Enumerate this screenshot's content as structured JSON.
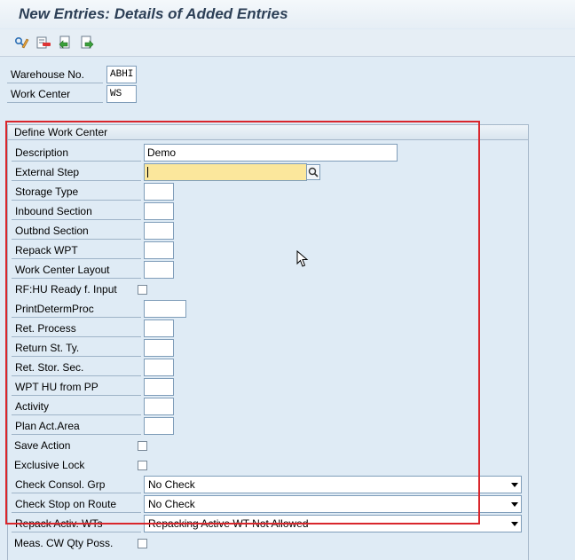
{
  "title": "New Entries: Details of Added Entries",
  "toolbar": [
    {
      "name": "display-change-icon"
    },
    {
      "name": "delete-icon"
    },
    {
      "name": "undo-icon"
    },
    {
      "name": "next-entry-icon"
    }
  ],
  "header": {
    "warehouse_label": "Warehouse No.",
    "warehouse_value": "ABHI",
    "workcenter_label": "Work Center",
    "workcenter_value": "WS"
  },
  "group": {
    "title": "Define Work Center",
    "description_label": "Description",
    "description_value": "Demo",
    "external_step_label": "External Step",
    "external_step_value": "",
    "storage_type_label": "Storage Type",
    "inbound_label": "Inbound Section",
    "outbound_label": "Outbnd Section",
    "repack_wpt_label": "Repack WPT",
    "wc_layout_label": "Work Center Layout",
    "rf_hu_label": "RF:HU Ready f. Input",
    "rf_hu_checked": false,
    "print_label": "PrintDetermProc",
    "ret_process_label": "Ret. Process",
    "return_st_label": "Return St. Ty.",
    "ret_stor_label": "Ret. Stor. Sec.",
    "wpt_hu_label": "WPT HU from PP",
    "activity_label": "Activity",
    "plan_act_label": "Plan Act.Area",
    "save_action_label": "Save Action",
    "save_action_checked": false,
    "excl_lock_label": "Exclusive Lock",
    "excl_lock_checked": false,
    "consol_label": "Check Consol. Grp",
    "consol_value": "No Check",
    "stop_route_label": "Check Stop on Route",
    "stop_route_value": "No Check",
    "repack_activ_label": "Repack Activ. WTs",
    "repack_activ_value": "Repacking Active WT Not Allowed",
    "meas_cw_label": "Meas. CW Qty Poss.",
    "meas_cw_checked": false
  }
}
